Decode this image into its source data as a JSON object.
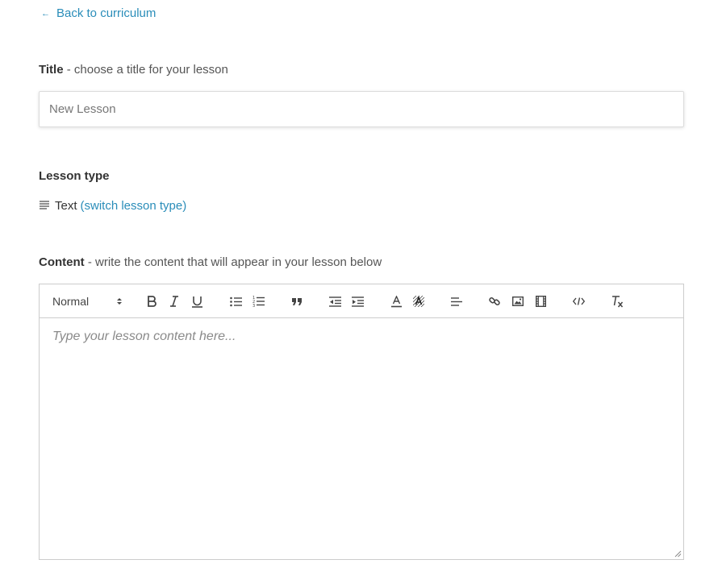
{
  "back_link": {
    "label": "Back to curriculum",
    "icon": "arrow-left-icon"
  },
  "title_field": {
    "label_bold": "Title",
    "label_rest": " - choose a title for your lesson",
    "placeholder": "New Lesson",
    "value": ""
  },
  "lesson_type": {
    "label": "Lesson type",
    "icon": "text-lines-icon",
    "type_name": "Text",
    "switch_label": "(switch lesson type)"
  },
  "content_field": {
    "label_bold": "Content",
    "label_rest": " - write the content that will appear in your lesson below",
    "editor_placeholder": "Type your lesson content here..."
  },
  "toolbar": {
    "format_select": "Normal",
    "buttons": [
      "bold-icon",
      "italic-icon",
      "underline-icon",
      "bullet-list-icon",
      "numbered-list-icon",
      "blockquote-icon",
      "outdent-icon",
      "indent-icon",
      "text-color-icon",
      "background-color-icon",
      "align-icon",
      "link-icon",
      "image-icon",
      "video-icon",
      "code-icon",
      "clear-format-icon"
    ]
  },
  "colors": {
    "link": "#2a8db9",
    "text": "#333333",
    "border": "#cccccc"
  }
}
